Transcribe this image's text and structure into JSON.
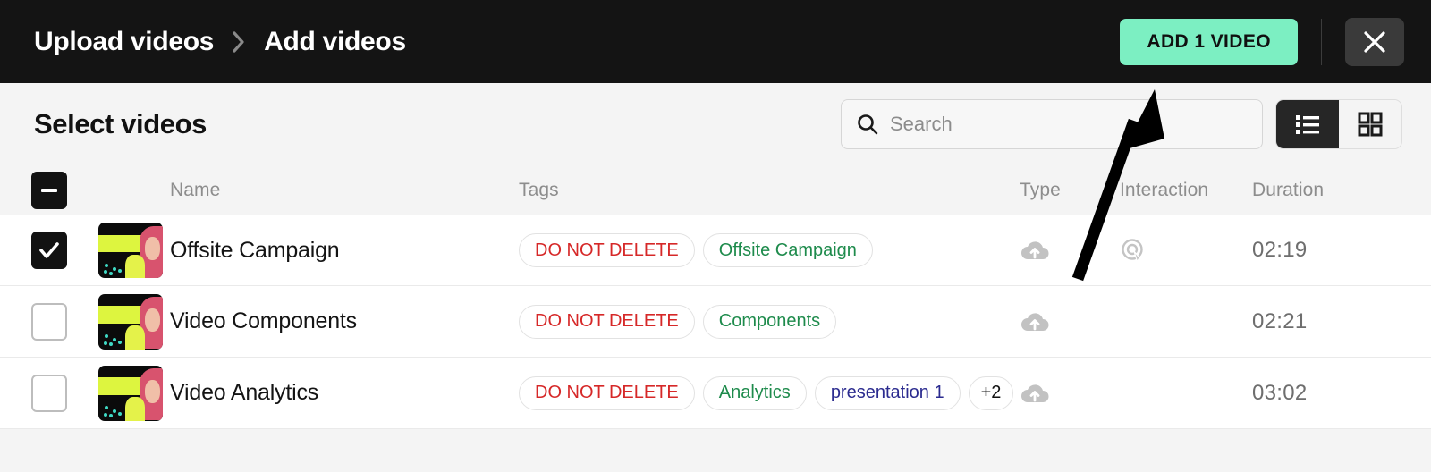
{
  "topbar": {
    "breadcrumb": [
      {
        "label": "Upload videos"
      },
      {
        "label": "Add videos"
      }
    ],
    "separator_icon": "chevron-right-icon",
    "add_button_label": "ADD 1 VIDEO",
    "close_icon": "close-icon",
    "accent_color": "#7cefc2",
    "background_color": "#141414"
  },
  "main": {
    "title": "Select videos",
    "search": {
      "placeholder": "Search",
      "value": "",
      "icon": "search-icon"
    },
    "view_toggle": {
      "list_icon": "list-view-icon",
      "grid_icon": "grid-view-icon",
      "active": "list"
    },
    "table": {
      "select_all_state": "indeterminate",
      "headers": {
        "name": "Name",
        "tags": "Tags",
        "type": "Type",
        "interaction": "Interaction",
        "duration": "Duration"
      },
      "rows": [
        {
          "checked": true,
          "name": "Offsite Campaign",
          "tags": [
            {
              "label": "DO NOT DELETE",
              "color": "red"
            },
            {
              "label": "Offsite Campaign",
              "color": "green"
            }
          ],
          "type_icon": "cloud-upload-icon",
          "interaction_icon": "interaction-target-icon",
          "duration": "02:19"
        },
        {
          "checked": false,
          "name": "Video Components",
          "tags": [
            {
              "label": "DO NOT DELETE",
              "color": "red"
            },
            {
              "label": "Components",
              "color": "green"
            }
          ],
          "type_icon": "cloud-upload-icon",
          "interaction_icon": "",
          "duration": "02:21"
        },
        {
          "checked": false,
          "name": "Video Analytics",
          "tags": [
            {
              "label": "DO NOT DELETE",
              "color": "red"
            },
            {
              "label": "Analytics",
              "color": "green"
            },
            {
              "label": "presentation 1",
              "color": "navy"
            },
            {
              "label": "+2",
              "color": "plain"
            }
          ],
          "type_icon": "cloud-upload-icon",
          "interaction_icon": "",
          "duration": "03:02"
        }
      ]
    }
  },
  "annotation": {
    "arrow_icon": "annotation-arrow-icon"
  }
}
